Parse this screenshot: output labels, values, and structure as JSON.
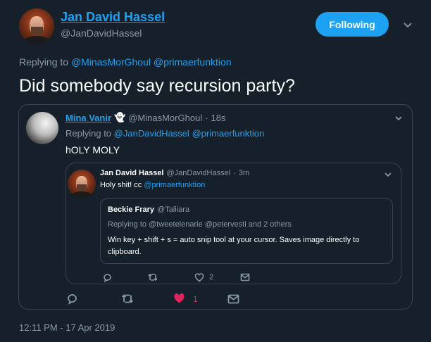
{
  "main_tweet": {
    "author_name": "Jan David Hassel",
    "handle": "@JanDavidHassel",
    "follow_label": "Following",
    "replying_prefix": "Replying to",
    "replying_to": [
      "@MinasMorGhoul",
      "@primaerfunktion"
    ],
    "text": "Did somebody say recursion party?",
    "timestamp": "12:11 PM - 17 Apr 2019"
  },
  "quote1": {
    "author_name": "Mina Vanir",
    "emoji": "👻",
    "handle": "@MinasMorGhoul",
    "sep": "·",
    "time": "18s",
    "replying_prefix": "Replying to",
    "replying_to": [
      "@JanDavidHassel",
      "@primaerfunktion"
    ],
    "text": "hOLY MOLY",
    "actions": {
      "reply_count": "",
      "retweet_count": "",
      "like_count": "1",
      "liked": true
    }
  },
  "quote2": {
    "author_name": "Jan David Hassel",
    "handle": "@JanDavidHassel",
    "sep": "·",
    "time": "3m",
    "text_prefix": "Holy shit! cc",
    "mention": "@primaerfunktion",
    "actions": {
      "like_count": "2"
    }
  },
  "quote3": {
    "author_name": "Beckie Frary",
    "handle": "@Taliiara",
    "replying_prefix": "Replying to",
    "replying_to": [
      "@tweetelenarie",
      "@petervesti"
    ],
    "replying_suffix": "and 2 others",
    "text": "Win key + shift + s = auto snip tool at your cursor. Saves image directly to clipboard."
  },
  "colors": {
    "background": "#15202b",
    "accent": "#1da1f2",
    "muted": "#8899a6",
    "border": "#38444d",
    "like": "#e0245e"
  }
}
